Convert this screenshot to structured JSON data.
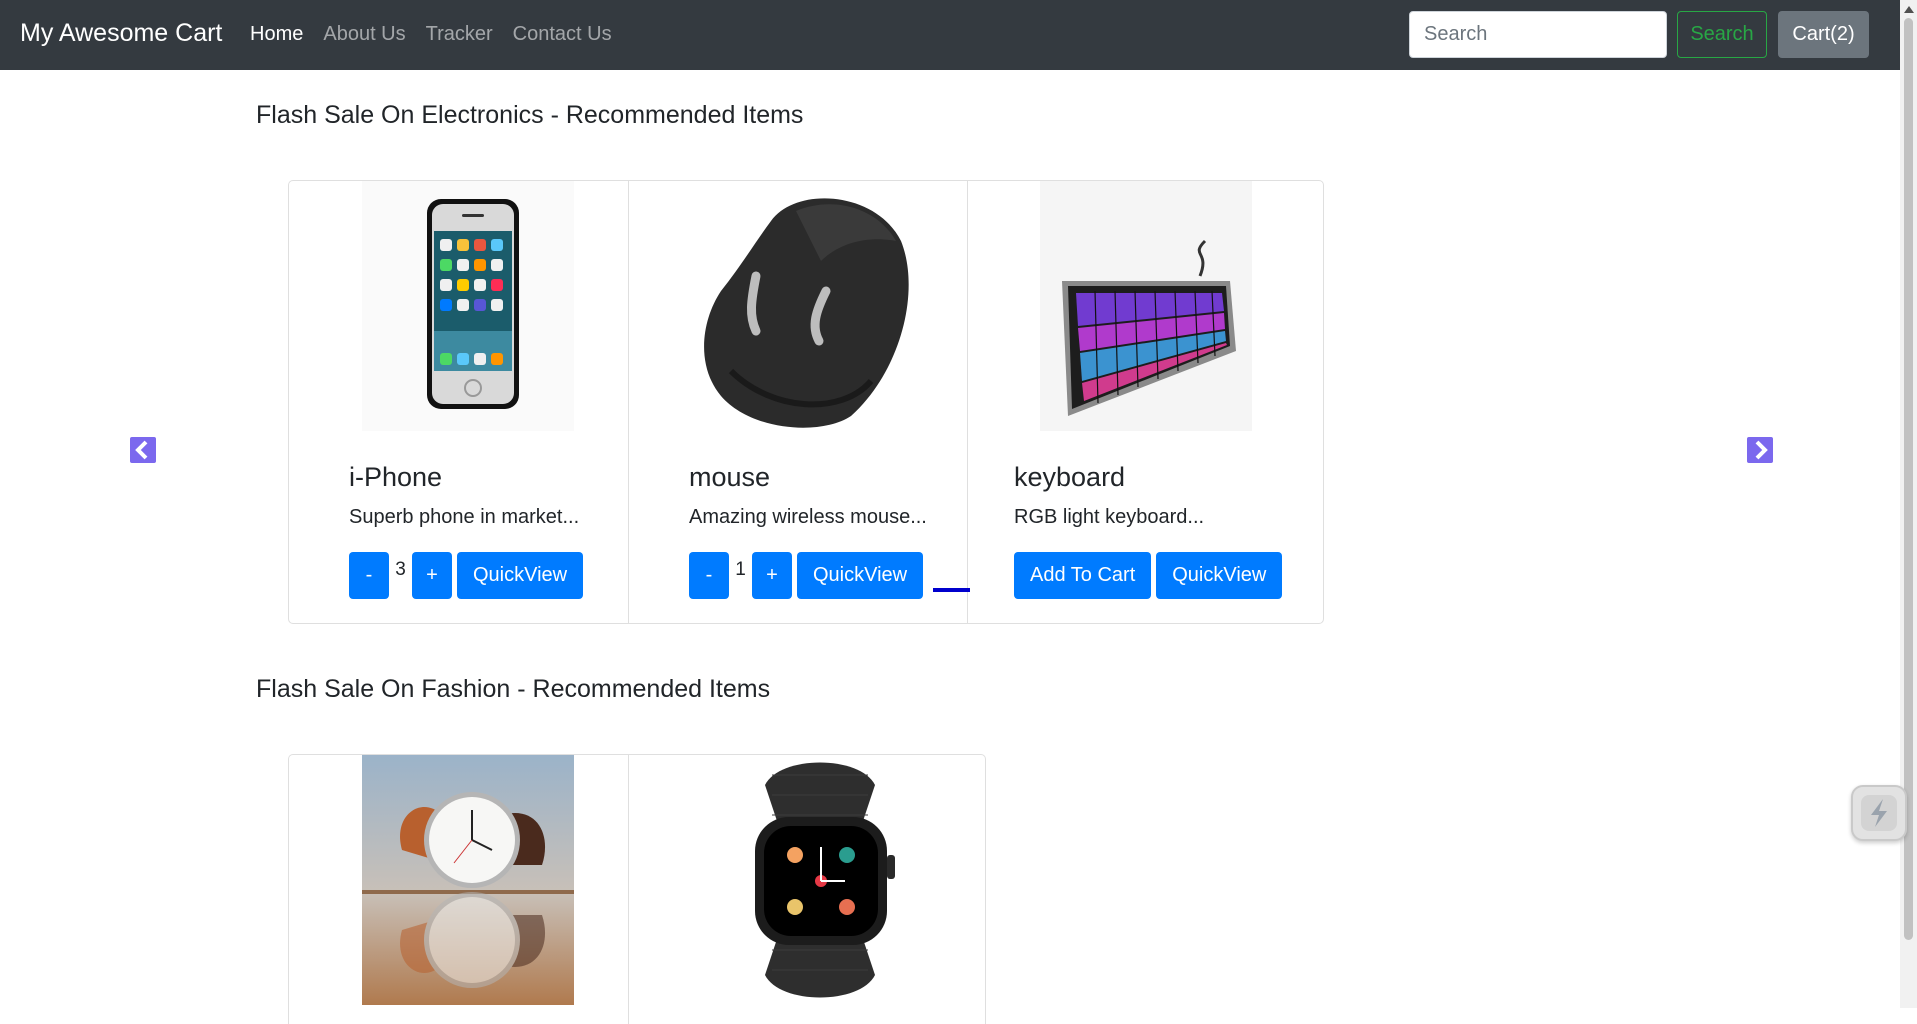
{
  "navbar": {
    "brand": "My Awesome Cart",
    "links": [
      "Home",
      "About Us",
      "Tracker",
      "Contact Us"
    ],
    "search_placeholder": "Search",
    "search_button": "Search",
    "cart_button": "Cart(2)"
  },
  "sections": [
    {
      "title": "Flash Sale On Electronics - Recommended Items",
      "products": [
        {
          "name": "i-Phone",
          "description": "Superb phone in market...",
          "qty": "3",
          "minus": "-",
          "plus": "+",
          "quickview": "QuickView"
        },
        {
          "name": "mouse",
          "description": "Amazing wireless mouse...",
          "qty": "1",
          "minus": "-",
          "plus": "+",
          "quickview": "QuickView"
        },
        {
          "name": "keyboard",
          "description": "RGB light keyboard...",
          "add_to_cart": "Add To Cart",
          "quickview": "QuickView"
        }
      ]
    },
    {
      "title": "Flash Sale On Fashion - Recommended Items",
      "products": [
        {
          "image": "wrist-watch"
        },
        {
          "image": "smart-watch"
        }
      ]
    }
  ],
  "colors": {
    "navbar_bg": "#343a40",
    "primary": "#007bff",
    "success": "#28a745",
    "secondary": "#6c757d",
    "carousel_arrow": "#7b68ee",
    "indicator": "#0000cd"
  },
  "icons": {
    "prev": "chevron-left-icon",
    "next": "chevron-right-icon",
    "widget": "lightning-icon"
  }
}
